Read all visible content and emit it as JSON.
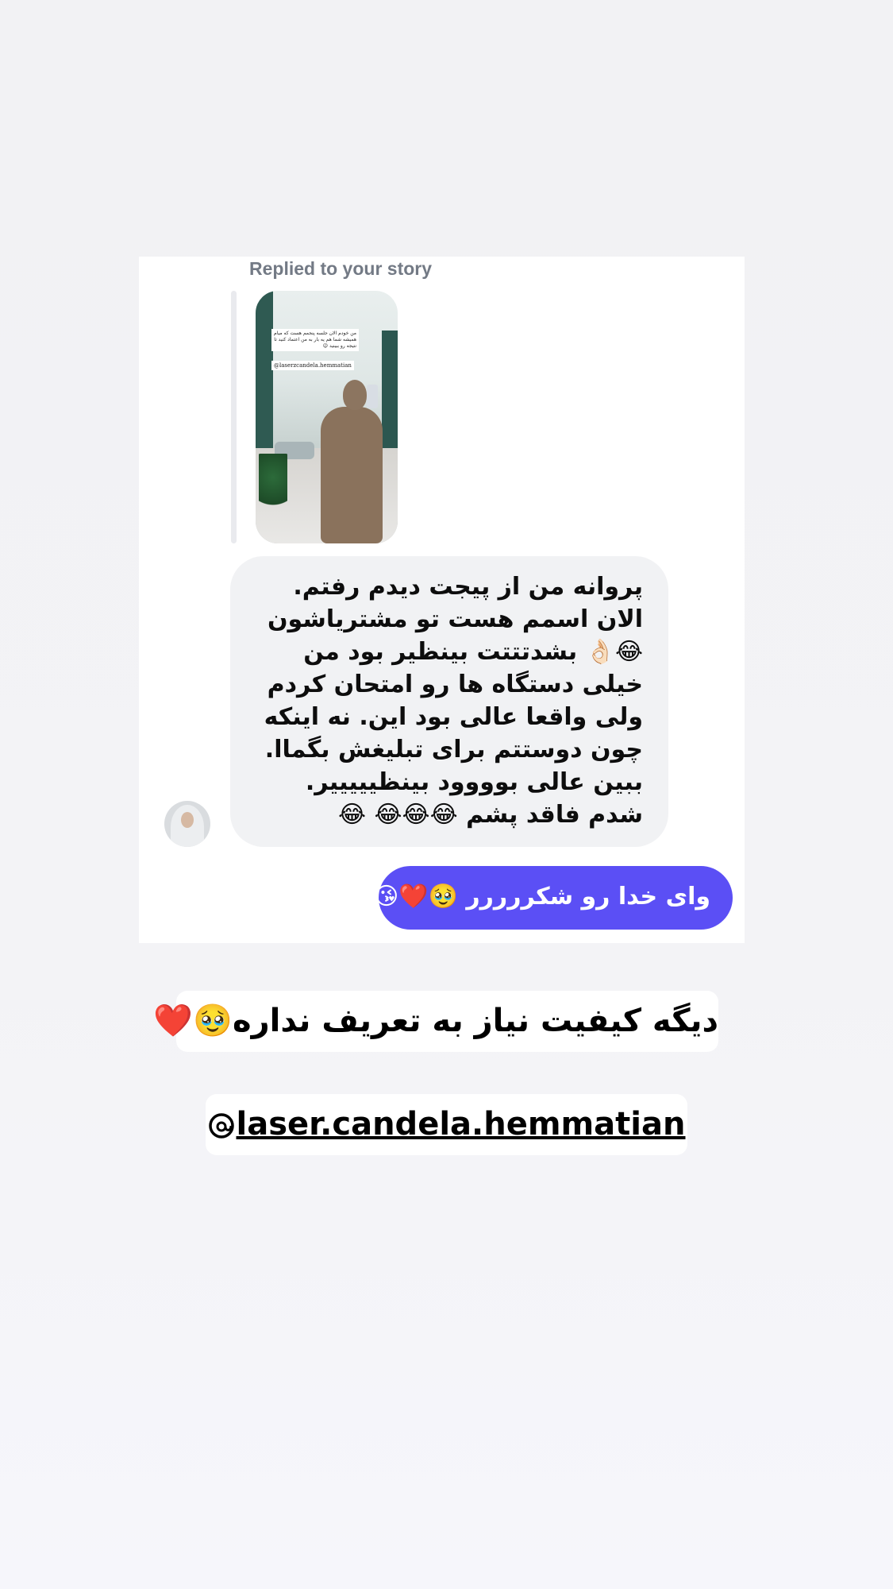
{
  "story_reply": {
    "caption": "Replied to your story",
    "thumbnail": {
      "overlay_text": "من خودم الان جلسه پنجمم هست که میام همیشه شما هم یه بار به من اعتماد کنید تا نتیجه رو ببینید 😉",
      "tag": "@laserzcandela.hemmatian"
    }
  },
  "incoming_message": {
    "text": "پروانه من از پیجت دیدم رفتم. الان اسمم هست تو مشتریاشون 😂👌🏻 بشدتتتت بینظیر بود من خیلی دستگاه ها رو امتحان کردم ولی واقعا عالی بود این. نه اینکه چون دوستتم برای تبلیغش بگماا. ببین عالی بوووود بینظیییییر. شدم فاقد پشم 😂😂😂 😂"
  },
  "outgoing_message": {
    "text": "وای خدا رو شکررررر 🥹❤️😘"
  },
  "caption_banner": {
    "text": "دیگه کیفیت نیاز به تعریف نداره🥹❤️"
  },
  "handle_banner": {
    "icon": "threads-icon",
    "text": "laser.candela.hemmatian"
  },
  "colors": {
    "outgoing_bubble": "#5b4ff5",
    "incoming_bubble": "#f1f2f4",
    "caption_gray": "#737a85"
  }
}
